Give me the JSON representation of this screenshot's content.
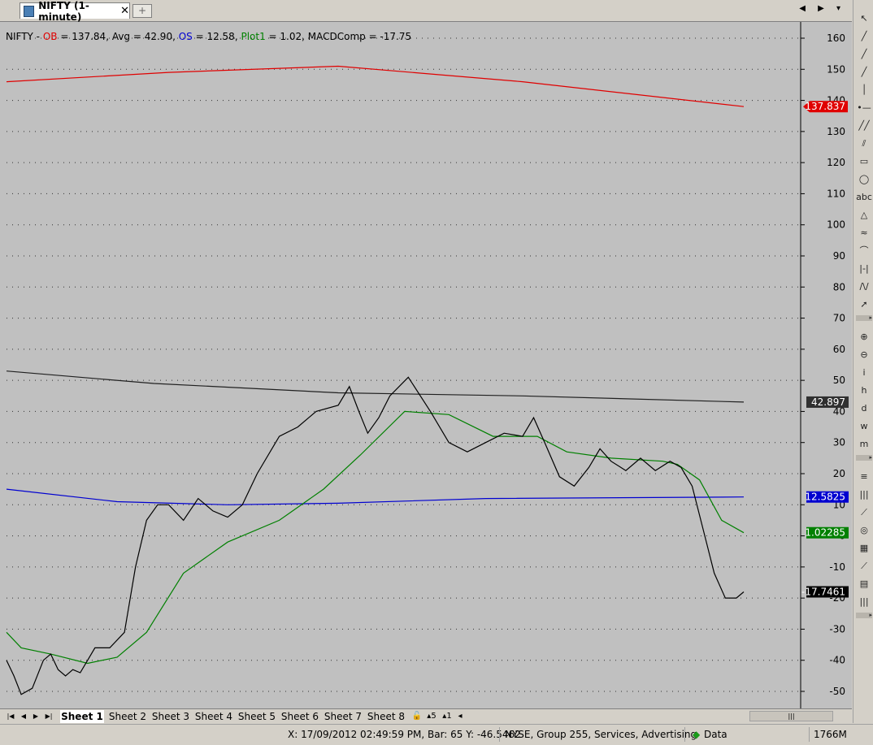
{
  "tab": {
    "title": "NIFTY (1-minute)",
    "close": "✕",
    "add": "+"
  },
  "tab_nav": "◀ ▶ ▾",
  "legend": {
    "prefix": "NIFTY - ",
    "ob_label": "OB",
    "ob_value": " = 137.84, Avg = 42.90, ",
    "os_label": "OS",
    "os_value": " = 12.58, ",
    "plot_label": "Plot1",
    "plot_value": " = 1.02, MACDComp = -17.75"
  },
  "chart_data": {
    "type": "line",
    "ylim": [
      -55,
      164
    ],
    "y_ticks": [
      160,
      150,
      140,
      130,
      120,
      110,
      100,
      90,
      80,
      70,
      60,
      50,
      40,
      30,
      20,
      10,
      0,
      -10,
      -20,
      -30,
      -40,
      -50
    ],
    "x": [
      0,
      1000
    ],
    "series": [
      {
        "name": "OB",
        "color": "#e00000",
        "points": [
          [
            0,
            146
          ],
          [
            220,
            149
          ],
          [
            450,
            151
          ],
          [
            700,
            146
          ],
          [
            1000,
            138
          ]
        ],
        "label": "137.837"
      },
      {
        "name": "Avg",
        "color": "#202020",
        "points": [
          [
            0,
            53
          ],
          [
            200,
            49
          ],
          [
            450,
            46
          ],
          [
            700,
            45
          ],
          [
            1000,
            43
          ]
        ],
        "label": "42.897"
      },
      {
        "name": "OS",
        "color": "#0000d0",
        "points": [
          [
            0,
            15
          ],
          [
            150,
            11
          ],
          [
            300,
            10
          ],
          [
            450,
            10.5
          ],
          [
            650,
            12
          ],
          [
            1000,
            12.5
          ]
        ],
        "label": "12.5825"
      },
      {
        "name": "Plot1",
        "color": "#008000",
        "points": [
          [
            0,
            -31
          ],
          [
            20,
            -36
          ],
          [
            60,
            -38
          ],
          [
            110,
            -41
          ],
          [
            150,
            -39
          ],
          [
            190,
            -31
          ],
          [
            240,
            -12
          ],
          [
            300,
            -2
          ],
          [
            370,
            5
          ],
          [
            430,
            15
          ],
          [
            480,
            26
          ],
          [
            540,
            40
          ],
          [
            600,
            39
          ],
          [
            660,
            32
          ],
          [
            720,
            32
          ],
          [
            760,
            27
          ],
          [
            820,
            25
          ],
          [
            890,
            24
          ],
          [
            910,
            23
          ],
          [
            940,
            18
          ],
          [
            970,
            5
          ],
          [
            1000,
            1
          ]
        ],
        "label": "1.02285"
      },
      {
        "name": "MACDComp",
        "color": "#000000",
        "points": [
          [
            0,
            -40
          ],
          [
            10,
            -45
          ],
          [
            20,
            -51
          ],
          [
            35,
            -49
          ],
          [
            50,
            -40
          ],
          [
            60,
            -38
          ],
          [
            70,
            -43
          ],
          [
            80,
            -45
          ],
          [
            90,
            -43
          ],
          [
            100,
            -44
          ],
          [
            110,
            -40
          ],
          [
            120,
            -36
          ],
          [
            140,
            -36
          ],
          [
            160,
            -31
          ],
          [
            175,
            -10
          ],
          [
            190,
            5
          ],
          [
            205,
            10
          ],
          [
            220,
            10
          ],
          [
            240,
            5
          ],
          [
            260,
            12
          ],
          [
            280,
            8
          ],
          [
            300,
            6
          ],
          [
            320,
            10
          ],
          [
            340,
            20
          ],
          [
            370,
            32
          ],
          [
            395,
            35
          ],
          [
            420,
            40
          ],
          [
            450,
            42
          ],
          [
            465,
            48
          ],
          [
            478,
            40
          ],
          [
            490,
            33
          ],
          [
            505,
            38
          ],
          [
            520,
            45
          ],
          [
            545,
            51
          ],
          [
            575,
            40
          ],
          [
            600,
            30
          ],
          [
            625,
            27
          ],
          [
            650,
            30
          ],
          [
            675,
            33
          ],
          [
            700,
            32
          ],
          [
            715,
            38
          ],
          [
            730,
            30
          ],
          [
            750,
            19
          ],
          [
            770,
            16
          ],
          [
            790,
            22
          ],
          [
            805,
            28
          ],
          [
            820,
            24
          ],
          [
            840,
            21
          ],
          [
            860,
            25
          ],
          [
            880,
            21
          ],
          [
            900,
            24
          ],
          [
            915,
            22
          ],
          [
            930,
            16
          ],
          [
            945,
            2
          ],
          [
            960,
            -12
          ],
          [
            975,
            -20
          ],
          [
            990,
            -20
          ],
          [
            1000,
            -18
          ]
        ],
        "label": "-17.7461"
      }
    ]
  },
  "toolbar": [
    "↖",
    "╱",
    "╱",
    "╱",
    "│",
    "•—",
    "╱╱",
    "⫽",
    "▭",
    "◯",
    "abc",
    "△",
    "≈",
    "⌒",
    "|-|",
    "∕\\∕",
    "➚",
    "▸",
    "⊕",
    "⊖",
    "i",
    "h",
    "d",
    "w",
    "m",
    "▸",
    "≡",
    "|||",
    "⟋",
    "◎",
    "▦",
    "⟋",
    "▤",
    "|||",
    "▸"
  ],
  "sheets": {
    "nav": [
      "|◀",
      "◀",
      "▶",
      "▶|"
    ],
    "tabs": [
      "Sheet 1",
      "Sheet 2",
      "Sheet 3",
      "Sheet 4",
      "Sheet 5",
      "Sheet 6",
      "Sheet 7",
      "Sheet 8"
    ],
    "extra": [
      "🔓",
      "▴5",
      "▴1",
      "◂"
    ],
    "scroll": "|||"
  },
  "status": {
    "coords": "X: 17/09/2012 02:49:59 PM, Bar: 65 Y: -46.5462",
    "symbol": "NYSE, Group 255, Services, Advertising",
    "data": "Data",
    "memory": "1766M"
  }
}
